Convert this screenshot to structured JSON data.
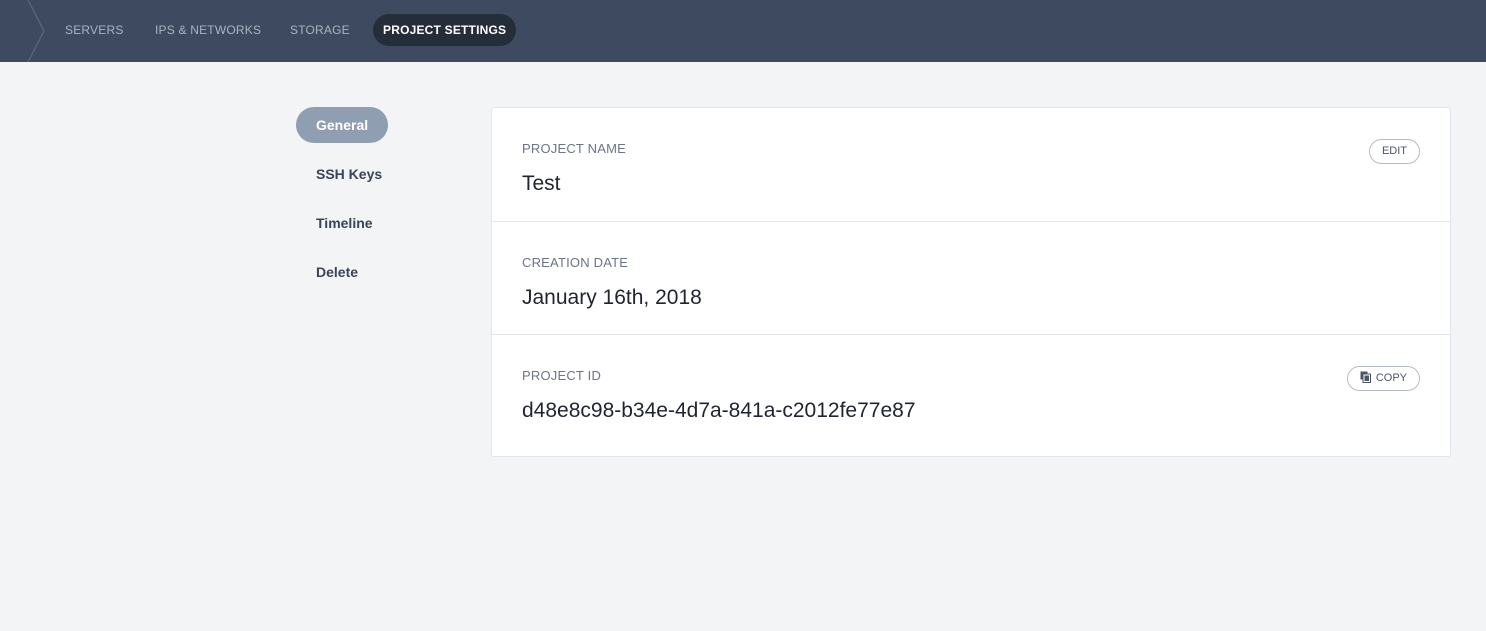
{
  "topnav": {
    "items": [
      {
        "label": "SERVERS",
        "active": false
      },
      {
        "label": "IPS & NETWORKS",
        "active": false
      },
      {
        "label": "STORAGE",
        "active": false
      },
      {
        "label": "PROJECT SETTINGS",
        "active": true
      }
    ],
    "icon": "breadcrumb-chevron-icon"
  },
  "sidebar": {
    "items": [
      {
        "label": "General",
        "active": true
      },
      {
        "label": "SSH Keys",
        "active": false
      },
      {
        "label": "Timeline",
        "active": false
      },
      {
        "label": "Delete",
        "active": false
      }
    ]
  },
  "settings": {
    "project_name": {
      "label": "PROJECT NAME",
      "value": "Test",
      "button": "EDIT"
    },
    "creation_date": {
      "label": "CREATION DATE",
      "value": "January 16th, 2018"
    },
    "project_id": {
      "label": "PROJECT ID",
      "value": "d48e8c98-b34e-4d7a-841a-c2012fe77e87",
      "button": "COPY",
      "button_icon": "copy-icon"
    }
  },
  "colors": {
    "topbar": "#3e4a5f",
    "active_nav": "#252d3b",
    "active_sidebar": "#8f9fb1",
    "background": "#f3f4f6"
  }
}
